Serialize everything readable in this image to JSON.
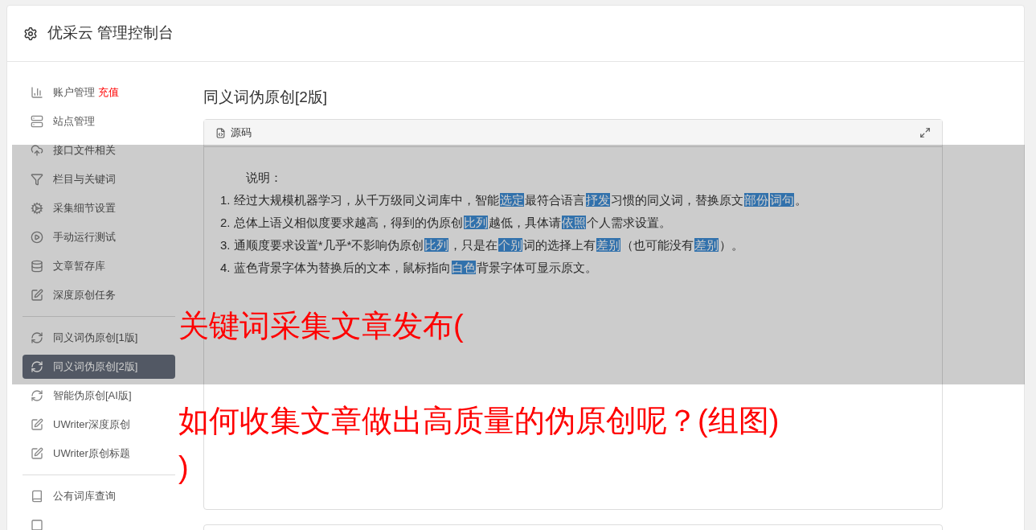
{
  "header": {
    "title": "优采云 管理控制台"
  },
  "sidebar": {
    "groups": [
      {
        "items": [
          {
            "label": "账户管理",
            "badge": "充值",
            "selected": false
          },
          {
            "label": "站点管理",
            "selected": false
          },
          {
            "label": "接口文件相关",
            "selected": false
          },
          {
            "label": "栏目与关键词",
            "selected": false
          },
          {
            "label": "采集细节设置",
            "selected": false
          },
          {
            "label": "手动运行测试",
            "selected": false
          },
          {
            "label": "文章暂存库",
            "selected": false
          },
          {
            "label": "深度原创任务",
            "selected": false
          }
        ]
      },
      {
        "items": [
          {
            "label": "同义词伪原创[1版]",
            "selected": false
          },
          {
            "label": "同义词伪原创[2版]",
            "selected": true
          },
          {
            "label": "智能伪原创[AI版]",
            "selected": false
          },
          {
            "label": "UWriter深度原创",
            "selected": false
          },
          {
            "label": "UWriter原创标题",
            "selected": false
          }
        ]
      },
      {
        "items": [
          {
            "label": "公有词库查询",
            "selected": false
          },
          {
            "selected": false
          }
        ]
      }
    ]
  },
  "content": {
    "title": "同义词伪原创[2版]",
    "editor": {
      "toolbar_label": "源码",
      "heading": "说明：",
      "lines": [
        [
          {
            "text": "1. 经过大规模机器学习，从千万级同义词库中，智能",
            "highlight": false
          },
          {
            "text": "选定",
            "highlight": true
          },
          {
            "text": "最符合语言",
            "highlight": false
          },
          {
            "text": "抒发",
            "highlight": true
          },
          {
            "text": "习惯的同义词，替换原文",
            "highlight": false
          },
          {
            "text": "部份",
            "highlight": true
          },
          {
            "text": "词句",
            "highlight": true
          },
          {
            "text": "。",
            "highlight": false
          }
        ],
        [
          {
            "text": "2. 总体上语义相似度要求越高，得到的伪原创",
            "highlight": false
          },
          {
            "text": "比列",
            "highlight": true
          },
          {
            "text": "越低，具体请",
            "highlight": false
          },
          {
            "text": "依照",
            "highlight": true
          },
          {
            "text": "个人需求设置。",
            "highlight": false
          }
        ],
        [
          {
            "text": "3. 通顺度要求设置*几乎*不影响伪原创",
            "highlight": false
          },
          {
            "text": "比列",
            "highlight": true
          },
          {
            "text": "，只是在",
            "highlight": false
          },
          {
            "text": "个别",
            "highlight": true
          },
          {
            "text": "词的选择上有",
            "highlight": false
          },
          {
            "text": "差别",
            "highlight": true
          },
          {
            "text": "（也可能没有",
            "highlight": false
          },
          {
            "text": "差别",
            "highlight": true
          },
          {
            "text": "）。",
            "highlight": false
          }
        ],
        [
          {
            "text": "4. 蓝色背景字体为替换后的文本，鼠标指向",
            "highlight": false
          },
          {
            "text": "白色",
            "highlight": true
          },
          {
            "text": "背景字体可显示原文。",
            "highlight": false
          }
        ]
      ]
    }
  },
  "overlay": {
    "lines": [
      "关键词采集文章发布(",
      "如何收集文章做出高质量的伪原创呢？(组图)",
      ")"
    ]
  }
}
